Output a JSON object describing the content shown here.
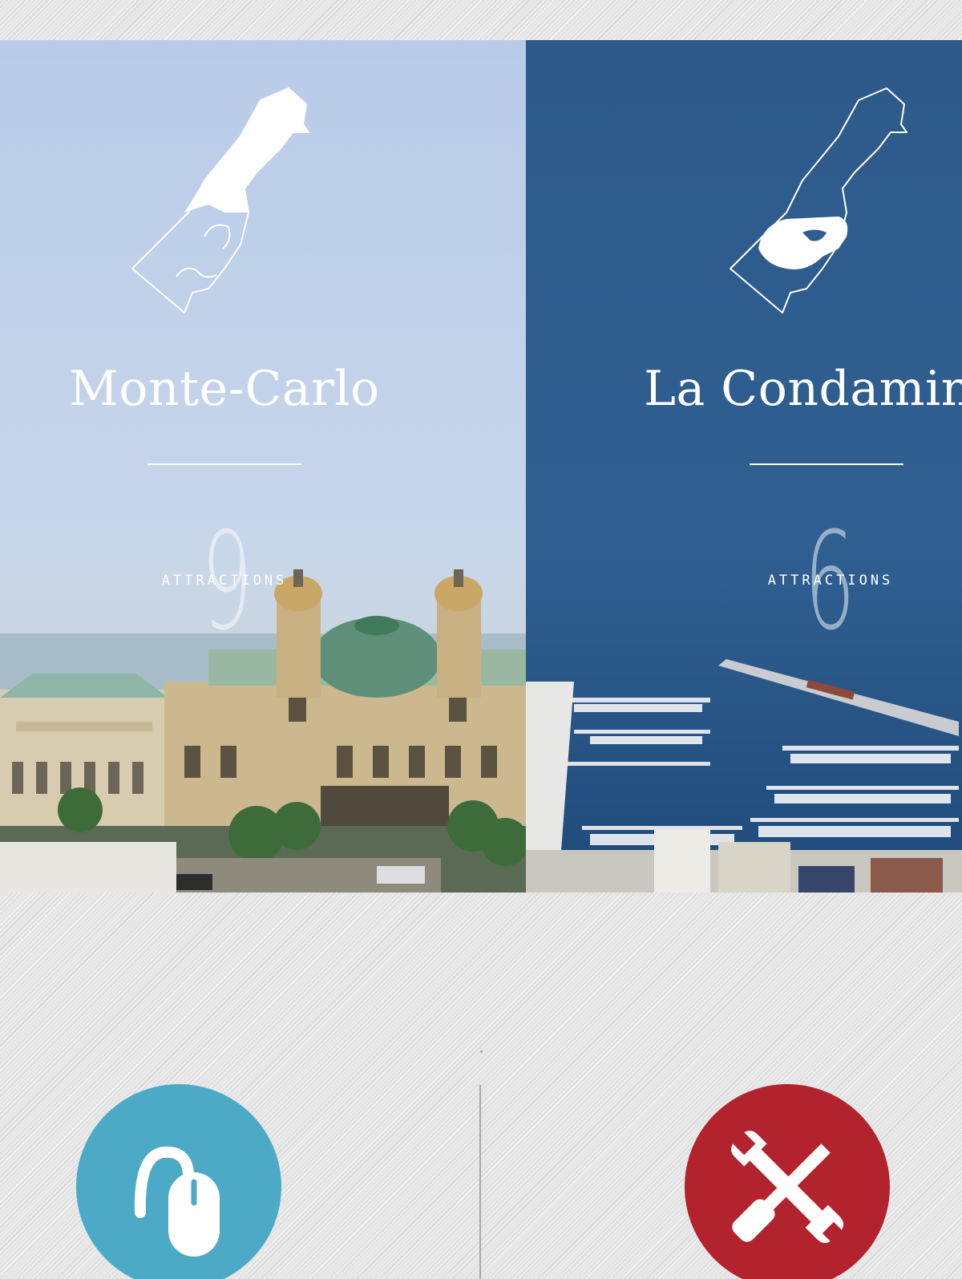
{
  "districts": [
    {
      "name": "Monte-Carlo",
      "count": "9",
      "label": "ATTRACTIONS"
    },
    {
      "name": "La Condamine",
      "count": "6",
      "label": "ATTRACTIONS"
    }
  ],
  "colors": {
    "monte_carlo_sky": "#bcd0ea",
    "la_condamine_blue": "#2f5d8e",
    "mouse_button": "#4daac7",
    "tools_button": "#b3232d"
  },
  "icons": {
    "left_button": "mouse-icon",
    "right_button": "tools-icon"
  }
}
